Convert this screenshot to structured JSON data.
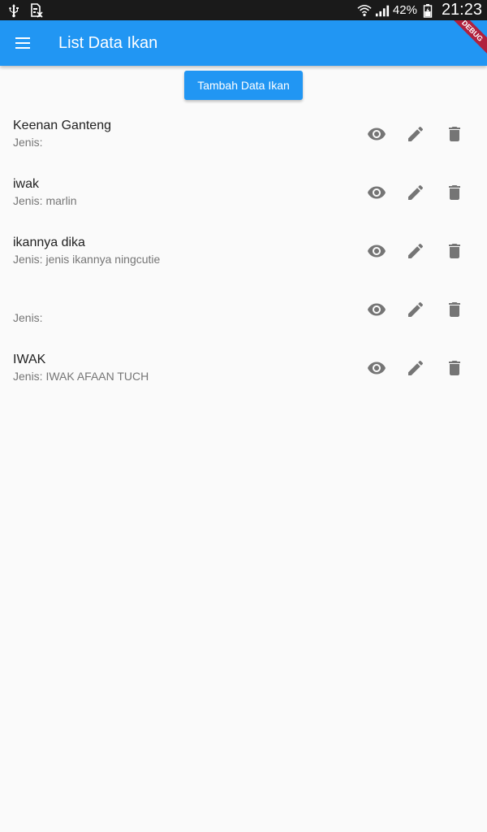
{
  "status_bar": {
    "battery_percent": "42%",
    "time": "21:23",
    "icons": [
      "usb-icon",
      "sim-card-x-icon",
      "wifi-icon",
      "signal-icon",
      "battery-charging-icon"
    ]
  },
  "app_bar": {
    "title": "List Data Ikan",
    "menu_icon": "hamburger-menu-icon",
    "debug_label": "DEBUG"
  },
  "add_button_label": "Tambah Data Ikan",
  "fish": [
    {
      "name": "Keenan Ganteng",
      "jenis": "Jenis: "
    },
    {
      "name": "iwak",
      "jenis": "Jenis: marlin"
    },
    {
      "name": "ikannya dika",
      "jenis": "Jenis: jenis ikannya ningcutie"
    },
    {
      "name": "",
      "jenis": "Jenis: "
    },
    {
      "name": "IWAK",
      "jenis": "Jenis: IWAK AFAAN TUCH"
    }
  ],
  "action_icons": [
    "eye-icon",
    "pencil-icon",
    "trash-icon"
  ],
  "colors": {
    "primary": "#2196f3",
    "icon": "#757575",
    "background": "#fafafa"
  }
}
